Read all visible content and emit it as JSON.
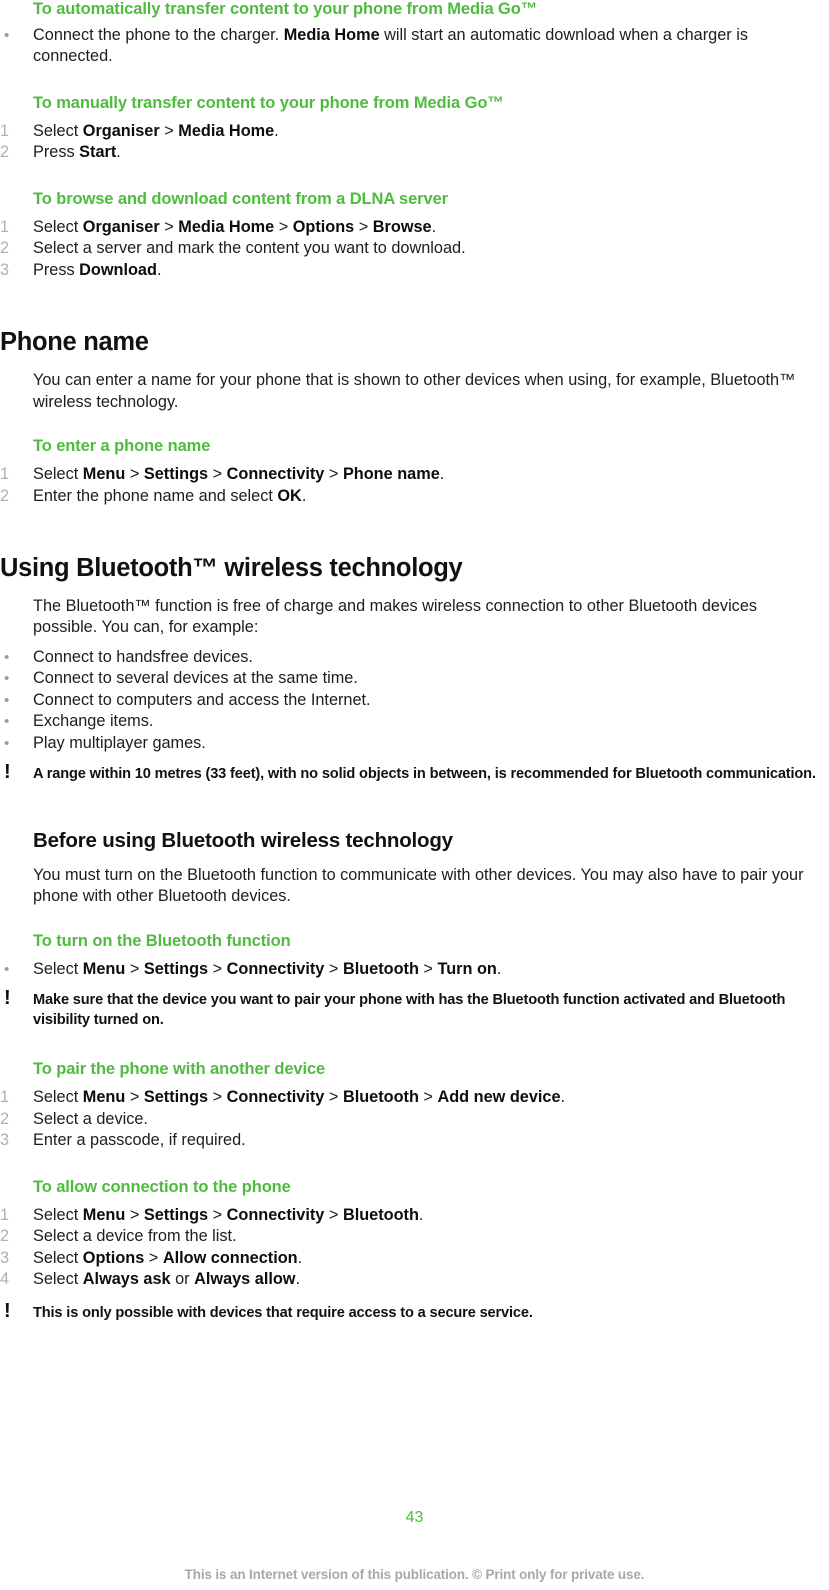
{
  "document": {
    "page_number": "43",
    "footer_note": "This is an Internet version of this publication. © Print only for private use.",
    "colors": {
      "heading_green": "#4fbb3f",
      "body_black": "#1d1d1d",
      "marker_gray": "#b0b0b0",
      "footer_gray": "#a8a8a8"
    }
  },
  "blocks": {
    "b1_heading": "To automatically transfer content to your phone from Media Go™",
    "b1_item1_pre": "Connect the phone to the charger. ",
    "b1_item1_bold": "Media Home",
    "b1_item1_post": " will start an automatic download when a charger is connected.",
    "b1_bullet": "•",
    "b2_heading": "To manually transfer content to your phone from Media Go™",
    "b2_item1_pre": "Select ",
    "b2_item1_b1": "Organiser",
    "b2_item1_sep1": " > ",
    "b2_item1_b2": "Media Home",
    "b2_item1_post": ".",
    "b2_item1_num": "1",
    "b2_item2_pre": "Press ",
    "b2_item2_b1": "Start",
    "b2_item2_post": ".",
    "b2_item2_num": "2",
    "b3_heading": "To browse and download content from a DLNA server",
    "b3_item1_num": "1",
    "b3_item1_pre": "Select ",
    "b3_item1_b1": "Organiser",
    "b3_item1_sep1": " > ",
    "b3_item1_b2": "Media Home",
    "b3_item1_sep2": " > ",
    "b3_item1_b3": "Options",
    "b3_item1_sep3": " > ",
    "b3_item1_b4": "Browse",
    "b3_item1_post": ".",
    "b3_item2_num": "2",
    "b3_item2_text": "Select a server and mark the content you want to download.",
    "b3_item3_num": "3",
    "b3_item3_pre": "Press ",
    "b3_item3_b1": "Download",
    "b3_item3_post": ".",
    "s1_title": "Phone name",
    "s1_para": "You can enter a name for your phone that is shown to other devices when using, for example, Bluetooth™ wireless technology.",
    "b4_heading": "To enter a phone name",
    "b4_item1_num": "1",
    "b4_item1_pre": "Select ",
    "b4_item1_b1": "Menu",
    "b4_item1_sep1": " > ",
    "b4_item1_b2": "Settings",
    "b4_item1_sep2": " > ",
    "b4_item1_b3": "Connectivity",
    "b4_item1_sep3": " > ",
    "b4_item1_b4": "Phone name",
    "b4_item1_post": ".",
    "b4_item2_num": "2",
    "b4_item2_pre": "Enter the phone name and select ",
    "b4_item2_b1": "OK",
    "b4_item2_post": ".",
    "s2_title": "Using Bluetooth™ wireless technology",
    "s2_para": "The Bluetooth™ function is free of charge and makes wireless connection to other Bluetooth devices possible. You can, for example:",
    "s2_bullets": [
      "Connect to handsfree devices.",
      "Connect to several devices at the same time.",
      "Connect to computers and access the Internet.",
      "Exchange items.",
      "Play multiplayer games."
    ],
    "s2_note": "A range within 10 metres (33 feet), with no solid objects in between, is recommended for Bluetooth communication.",
    "s3_title": "Before using Bluetooth wireless technology",
    "s3_para": "You must turn on the Bluetooth function to communicate with other devices. You may also have to pair your phone with other Bluetooth devices.",
    "b5_heading": "To turn on the Bluetooth function",
    "b5_item1_pre": "Select ",
    "b5_item1_b1": "Menu",
    "b5_item1_sep1": " > ",
    "b5_item1_b2": "Settings",
    "b5_item1_sep2": " > ",
    "b5_item1_b3": "Connectivity",
    "b5_item1_sep3": " > ",
    "b5_item1_b4": "Bluetooth",
    "b5_item1_sep4": " > ",
    "b5_item1_b5": "Turn on",
    "b5_item1_post": ".",
    "b5_note": "Make sure that the device you want to pair your phone with has the Bluetooth function activated and Bluetooth visibility turned on.",
    "b6_heading": "To pair the phone with another device",
    "b6_item1_num": "1",
    "b6_item1_pre": "Select ",
    "b6_item1_b1": "Menu",
    "b6_item1_sep1": " > ",
    "b6_item1_b2": "Settings",
    "b6_item1_sep2": " > ",
    "b6_item1_b3": "Connectivity",
    "b6_item1_sep3": " > ",
    "b6_item1_b4": "Bluetooth",
    "b6_item1_sep4": " > ",
    "b6_item1_b5": "Add new device",
    "b6_item1_post": ".",
    "b6_item2_num": "2",
    "b6_item2_text": "Select a device.",
    "b6_item3_num": "3",
    "b6_item3_text": "Enter a passcode, if required.",
    "b7_heading": "To allow connection to the phone",
    "b7_item1_num": "1",
    "b7_item1_pre": "Select ",
    "b7_item1_b1": "Menu",
    "b7_item1_sep1": " > ",
    "b7_item1_b2": "Settings",
    "b7_item1_sep2": " > ",
    "b7_item1_b3": "Connectivity",
    "b7_item1_sep3": " > ",
    "b7_item1_b4": "Bluetooth",
    "b7_item1_post": ".",
    "b7_item2_num": "2",
    "b7_item2_text": "Select a device from the list.",
    "b7_item3_num": "3",
    "b7_item3_pre": "Select ",
    "b7_item3_b1": "Options",
    "b7_item3_sep1": " > ",
    "b7_item3_b2": "Allow connection",
    "b7_item3_post": ".",
    "b7_item4_num": "4",
    "b7_item4_pre": "Select ",
    "b7_item4_b1": "Always ask",
    "b7_item4_mid": " or ",
    "b7_item4_b2": "Always allow",
    "b7_item4_post": ".",
    "b7_note": "This is only possible with devices that require access to a secure service.",
    "note_icon": "!"
  }
}
